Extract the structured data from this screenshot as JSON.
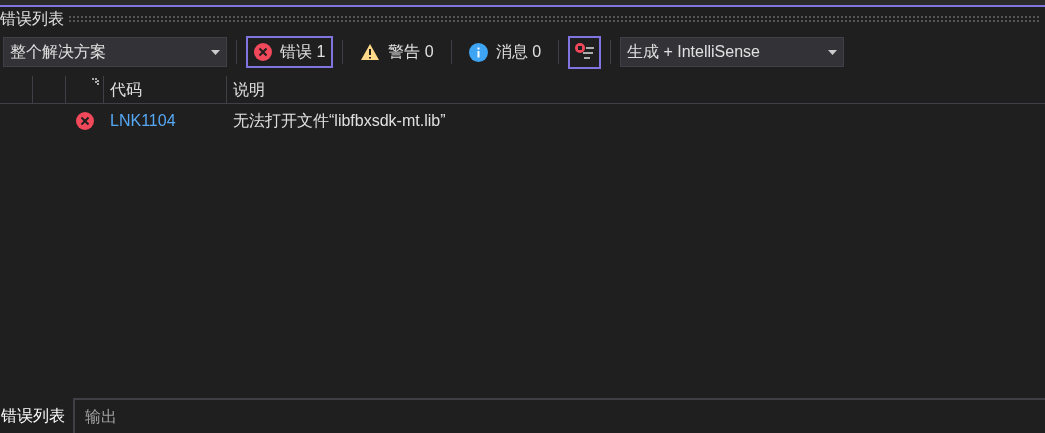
{
  "panel": {
    "title": "错误列表"
  },
  "scope_dropdown": {
    "value": "整个解决方案"
  },
  "filters": [
    {
      "kind": "error",
      "label": "错误 1",
      "selected": true
    },
    {
      "kind": "warning",
      "label": "警告 0",
      "selected": false
    },
    {
      "kind": "info",
      "label": "消息 0",
      "selected": false
    }
  ],
  "filter_toggle": {
    "selected": true
  },
  "source_dropdown": {
    "value": "生成 + IntelliSense"
  },
  "table": {
    "columns": [
      "代码",
      "说明"
    ],
    "rows": [
      {
        "kind": "error",
        "code": "LNK1104",
        "description": "无法打开文件“libfbxsdk-mt.lib”"
      }
    ]
  },
  "bottom_tabs": [
    {
      "label": "错误列表",
      "selected": true
    },
    {
      "label": "输出",
      "selected": false
    }
  ]
}
